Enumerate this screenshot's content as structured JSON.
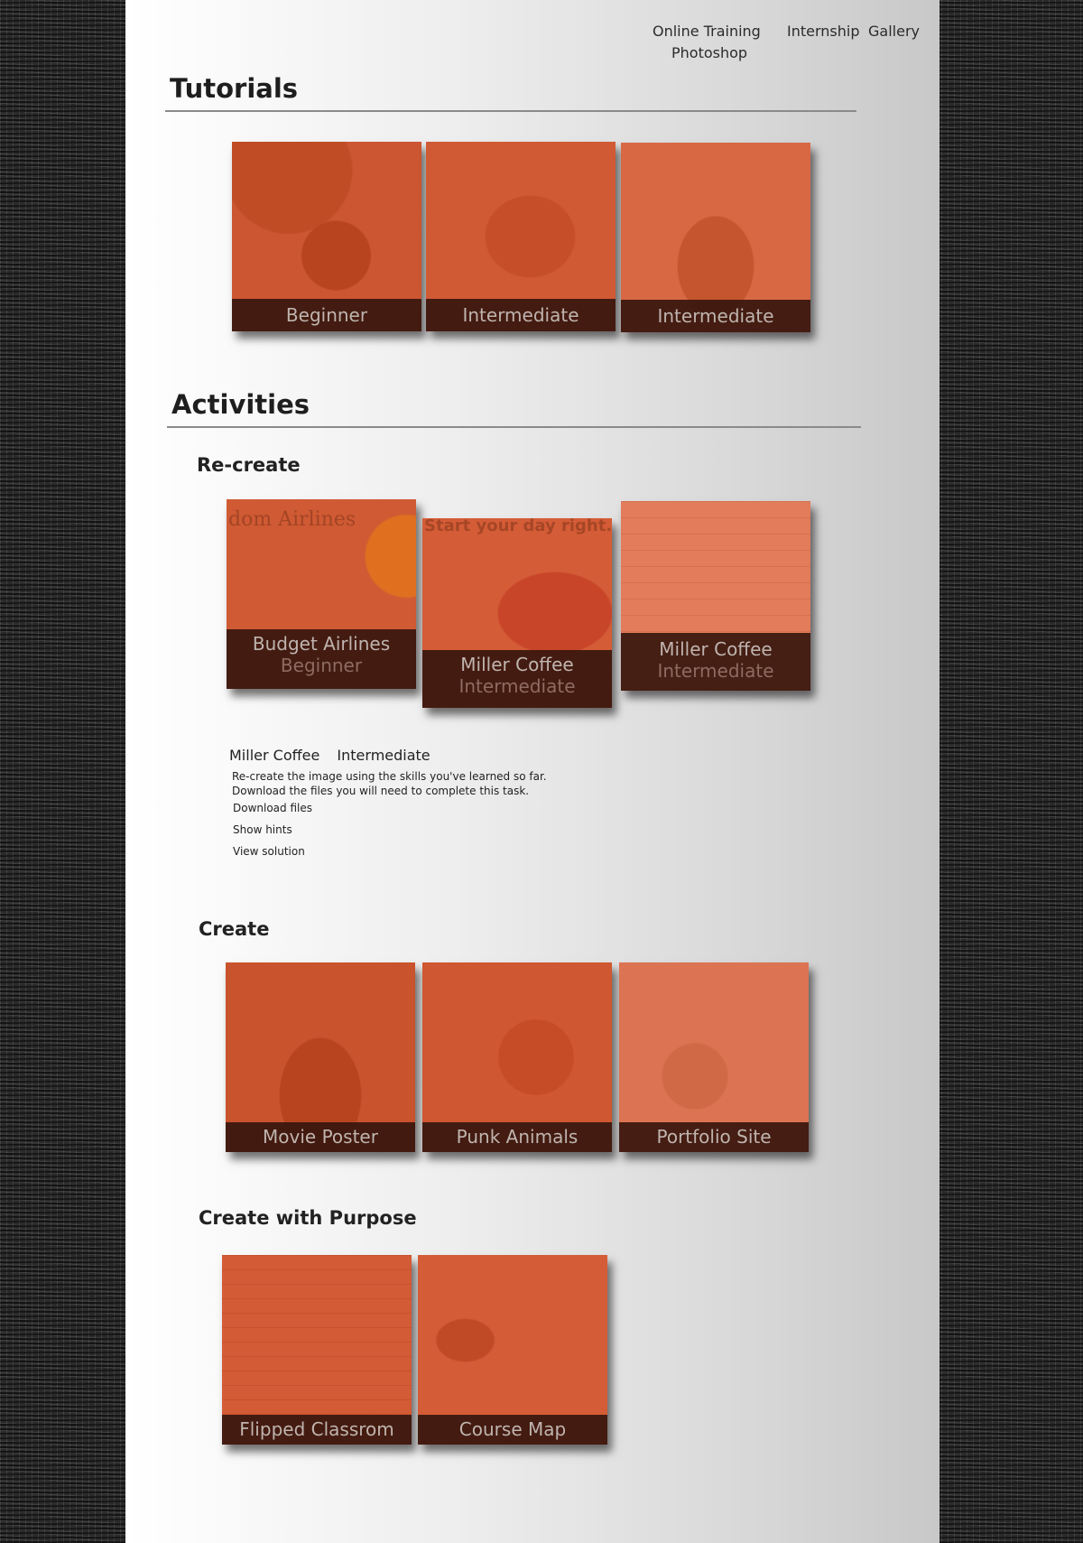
{
  "nav": {
    "online_training_label": "Online Training",
    "photoshop_label": "Photoshop",
    "internship_label": "Internship",
    "gallery_label": "Gallery"
  },
  "tutorials": {
    "title": "Tutorials",
    "cards": [
      {
        "label": "Beginner"
      },
      {
        "label": "Intermediate"
      },
      {
        "label": "Intermediate"
      }
    ]
  },
  "activities": {
    "title": "Activities",
    "recreate": {
      "title": "Re-create",
      "cards": [
        {
          "title": "Budget Airlines",
          "level": "Beginner",
          "ghost_text": "dom Airlines"
        },
        {
          "title": "Miller Coffee",
          "level": "Intermediate",
          "ghost_text": "Start your day right..."
        },
        {
          "title": "Miller Coffee",
          "level": "Intermediate"
        }
      ],
      "detail": {
        "name": "Miller Coffee",
        "level": "Intermediate",
        "description_line1": "Re-create the image using the skills you've learned so far.",
        "description_line2": "Download the files you will need to complete this task.",
        "download_link": "Download files",
        "hints_link": "Show hints",
        "solution_link": "View solution"
      }
    },
    "create": {
      "title": "Create",
      "cards": [
        {
          "title": "Movie Poster"
        },
        {
          "title": "Punk Animals"
        },
        {
          "title": "Portfolio Site"
        }
      ]
    },
    "create_with_purpose": {
      "title": "Create with Purpose",
      "cards": [
        {
          "title": "Flipped Classrom"
        },
        {
          "title": "Course Map"
        }
      ]
    }
  },
  "colors": {
    "card_orange": "#d4603a",
    "card_orange_light": "#e07a58",
    "card_orange_dark": "#c4502a",
    "label_bar": "#37160e",
    "heading_text": "#1e1e1e"
  }
}
